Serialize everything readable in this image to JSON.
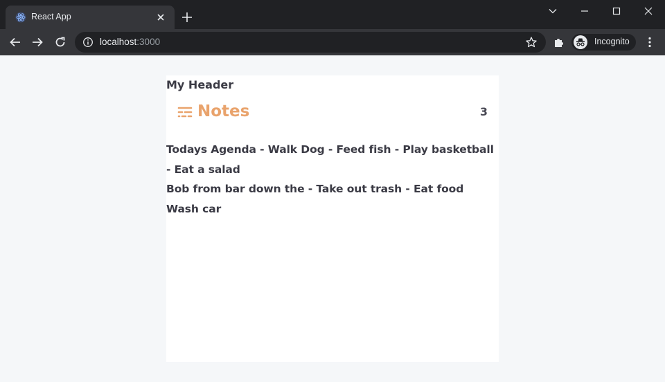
{
  "browser": {
    "tab_title": "React App",
    "url_host": "localhost",
    "url_port": ":3000",
    "profile_label": "Incognito",
    "icons": {
      "favicon": "react-logo-icon",
      "tab_close": "close-icon",
      "new_tab": "plus-icon",
      "tab_search": "chevron-down-icon",
      "minimize": "minimize-icon",
      "maximize": "maximize-icon",
      "close": "close-icon",
      "back": "arrow-left-icon",
      "forward": "arrow-right-icon",
      "reload": "reload-icon",
      "site_info": "info-icon",
      "bookmark": "star-icon",
      "extensions": "puzzle-icon",
      "incognito": "incognito-icon",
      "menu": "kebab-menu-icon"
    }
  },
  "page": {
    "header_text": "My Header",
    "notes": {
      "title": "Notes",
      "icon": "notes-list-icon",
      "count": "3",
      "accent_color": "#e9a36c",
      "items": [
        "Todays Agenda - Walk Dog - Feed fish - Play basketball - Eat a salad",
        "Bob from bar down the - Take out trash - Eat food",
        "Wash car"
      ]
    }
  }
}
